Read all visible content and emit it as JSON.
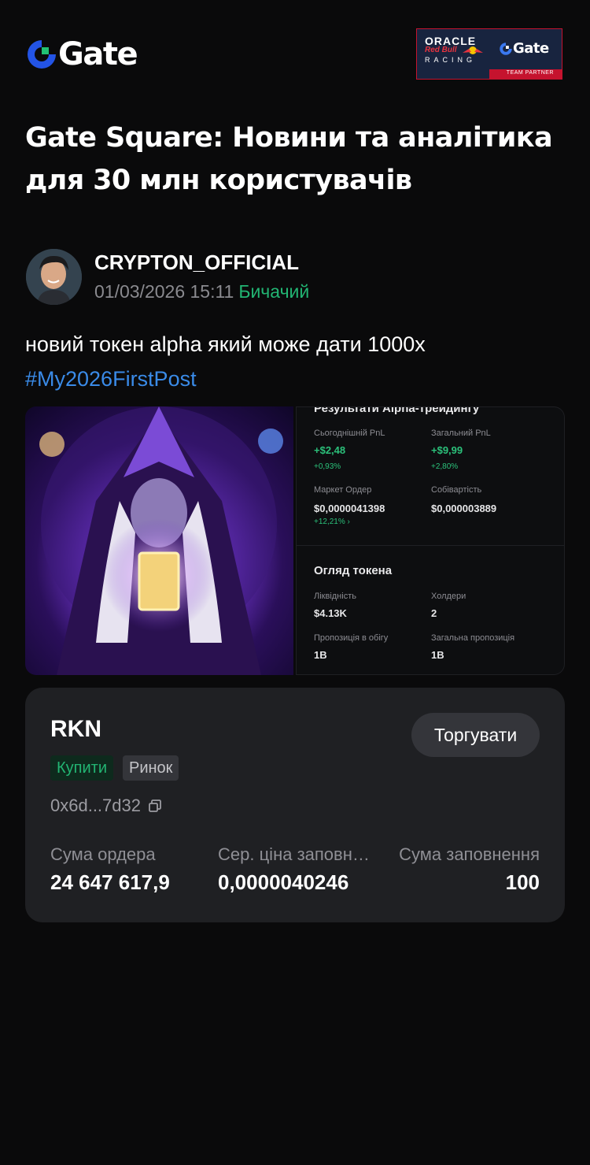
{
  "brand": {
    "logo_text": "Gate",
    "accent": "#2354e6",
    "green": "#22b573"
  },
  "partner": {
    "oracle": "ORACLE",
    "redbull": "Red Bull",
    "racing": "RACING",
    "gate": "Gate",
    "strip": "TEAM PARTNER"
  },
  "page_title": "Gate Square: Новини та аналітика для 30 млн користувачів",
  "post": {
    "author": "CRYPTON_OFFICIAL",
    "date": "01/03/2026 15:11",
    "sentiment": "Бичачий",
    "text": "новий токен alpha який може дати 1000x",
    "hashtag": "#My2026FirstPost"
  },
  "screenshot": {
    "section1_title": "Результати Alpha-трейдингу",
    "today_pnl_label": "Сьогоднішній PnL",
    "today_pnl": "+$2,48",
    "today_pnl_pct": "+0,93%",
    "total_pnl_label": "Загальний PnL",
    "total_pnl": "+$9,99",
    "total_pnl_pct": "+2,80%",
    "market_order_label": "Маркет Ордер",
    "market_order": "$0,0000041398",
    "market_order_pct": "+12,21% ›",
    "cost_label": "Собівартість",
    "cost": "$0,000003889",
    "section2_title": "Огляд токена",
    "liquidity_label": "Ліквідність",
    "liquidity": "$4.13K",
    "holders_label": "Холдери",
    "holders": "2",
    "circ_label": "Пропозиція в обігу",
    "circ": "1B",
    "total_supply_label": "Загальна пропозиція",
    "total_supply": "1B"
  },
  "trade_card": {
    "token": "RKN",
    "trade_button": "Торгувати",
    "tag_side": "Купити",
    "tag_type": "Ринок",
    "address": "0x6d...7d32",
    "order_amount_label": "Сума ордера",
    "order_amount": "24 647 617,9",
    "avg_price_label": "Сер. ціна заповн…",
    "avg_price": "0,0000040246",
    "fill_amount_label": "Сума заповнення",
    "fill_amount": "100"
  }
}
